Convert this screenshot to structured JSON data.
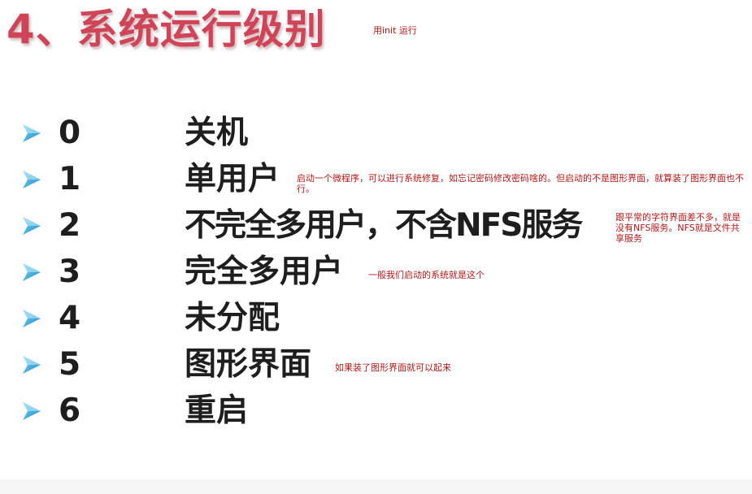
{
  "title": "4、系统运行级别",
  "title_note": "用init 运行",
  "levels": [
    {
      "num": "0",
      "label": "关机",
      "note": ""
    },
    {
      "num": "1",
      "label": "单用户",
      "note": "启动一个微程序，可以进行系统修复，如忘记密码修改密码啥的。但启动的不是图形界面，就算装了图形界面也不行。"
    },
    {
      "num": "2",
      "label": "不完全多用户，不含NFS服务",
      "note": "跟平常的字符界面差不多，就是没有NFS服务。NFS就是文件共享服务"
    },
    {
      "num": "3",
      "label": "完全多用户",
      "note": "一般我们启动的系统就是这个"
    },
    {
      "num": "4",
      "label": "未分配",
      "note": ""
    },
    {
      "num": "5",
      "label": "图形界面",
      "note": "如果装了图形界面就可以起来"
    },
    {
      "num": "6",
      "label": "重启",
      "note": ""
    }
  ],
  "icons": {
    "bullet": "arrow-bullet-icon"
  },
  "colors": {
    "title": "#cf4457",
    "note": "#b01818",
    "arrow": "#2a9fd6",
    "text": "#1e1e1e"
  }
}
